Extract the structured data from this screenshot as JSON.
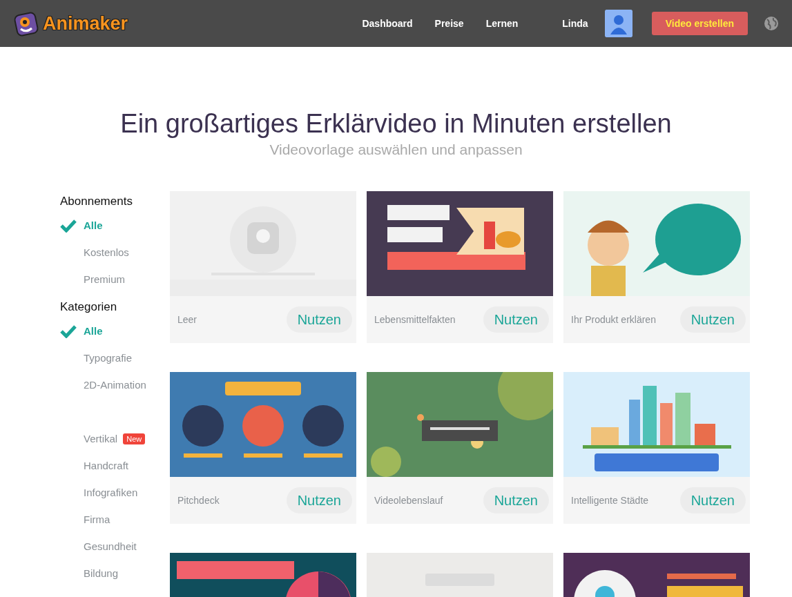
{
  "header": {
    "logo": "Animaker",
    "nav": [
      "Dashboard",
      "Preise",
      "Lernen"
    ],
    "user": "Linda",
    "cta": "Video erstellen"
  },
  "hero": {
    "title": "Ein großartiges Erklärvideo in Minuten erstellen",
    "subtitle": "Videovorlage auswählen und anpassen"
  },
  "sidebar": [
    {
      "heading": "Abonnements",
      "items": [
        {
          "label": "Alle",
          "selected": true
        },
        {
          "label": "Kostenlos",
          "selected": false
        },
        {
          "label": "Premium",
          "selected": false
        }
      ]
    },
    {
      "heading": "Kategorien",
      "items": [
        {
          "label": "Alle",
          "selected": true
        },
        {
          "label": "Typografie",
          "selected": false
        },
        {
          "label": "2D-Animation",
          "selected": false
        },
        {
          "label": "Vertikal",
          "selected": false,
          "badge": "New"
        },
        {
          "label": "Handcraft",
          "selected": false
        },
        {
          "label": "Infografiken",
          "selected": false
        },
        {
          "label": "Firma",
          "selected": false
        },
        {
          "label": "Gesundheit",
          "selected": false
        },
        {
          "label": "Bildung",
          "selected": false
        }
      ]
    }
  ],
  "templates": [
    {
      "kind": "template",
      "title": "Leer",
      "button": "Nutzen"
    },
    {
      "kind": "template",
      "title": "Lebensmittelfakten",
      "button": "Nutzen"
    },
    {
      "kind": "template",
      "title": "Ihr Produkt erklären",
      "button": "Nutzen"
    },
    {
      "kind": "template",
      "title": "Pitchdeck",
      "button": "Nutzen"
    },
    {
      "kind": "template",
      "title": "Videolebenslauf",
      "button": "Nutzen"
    },
    {
      "kind": "template",
      "title": "Intelligente Städte",
      "button": "Nutzen"
    },
    {
      "kind": "picture"
    },
    {
      "kind": "picture"
    },
    {
      "kind": "picture"
    }
  ]
}
